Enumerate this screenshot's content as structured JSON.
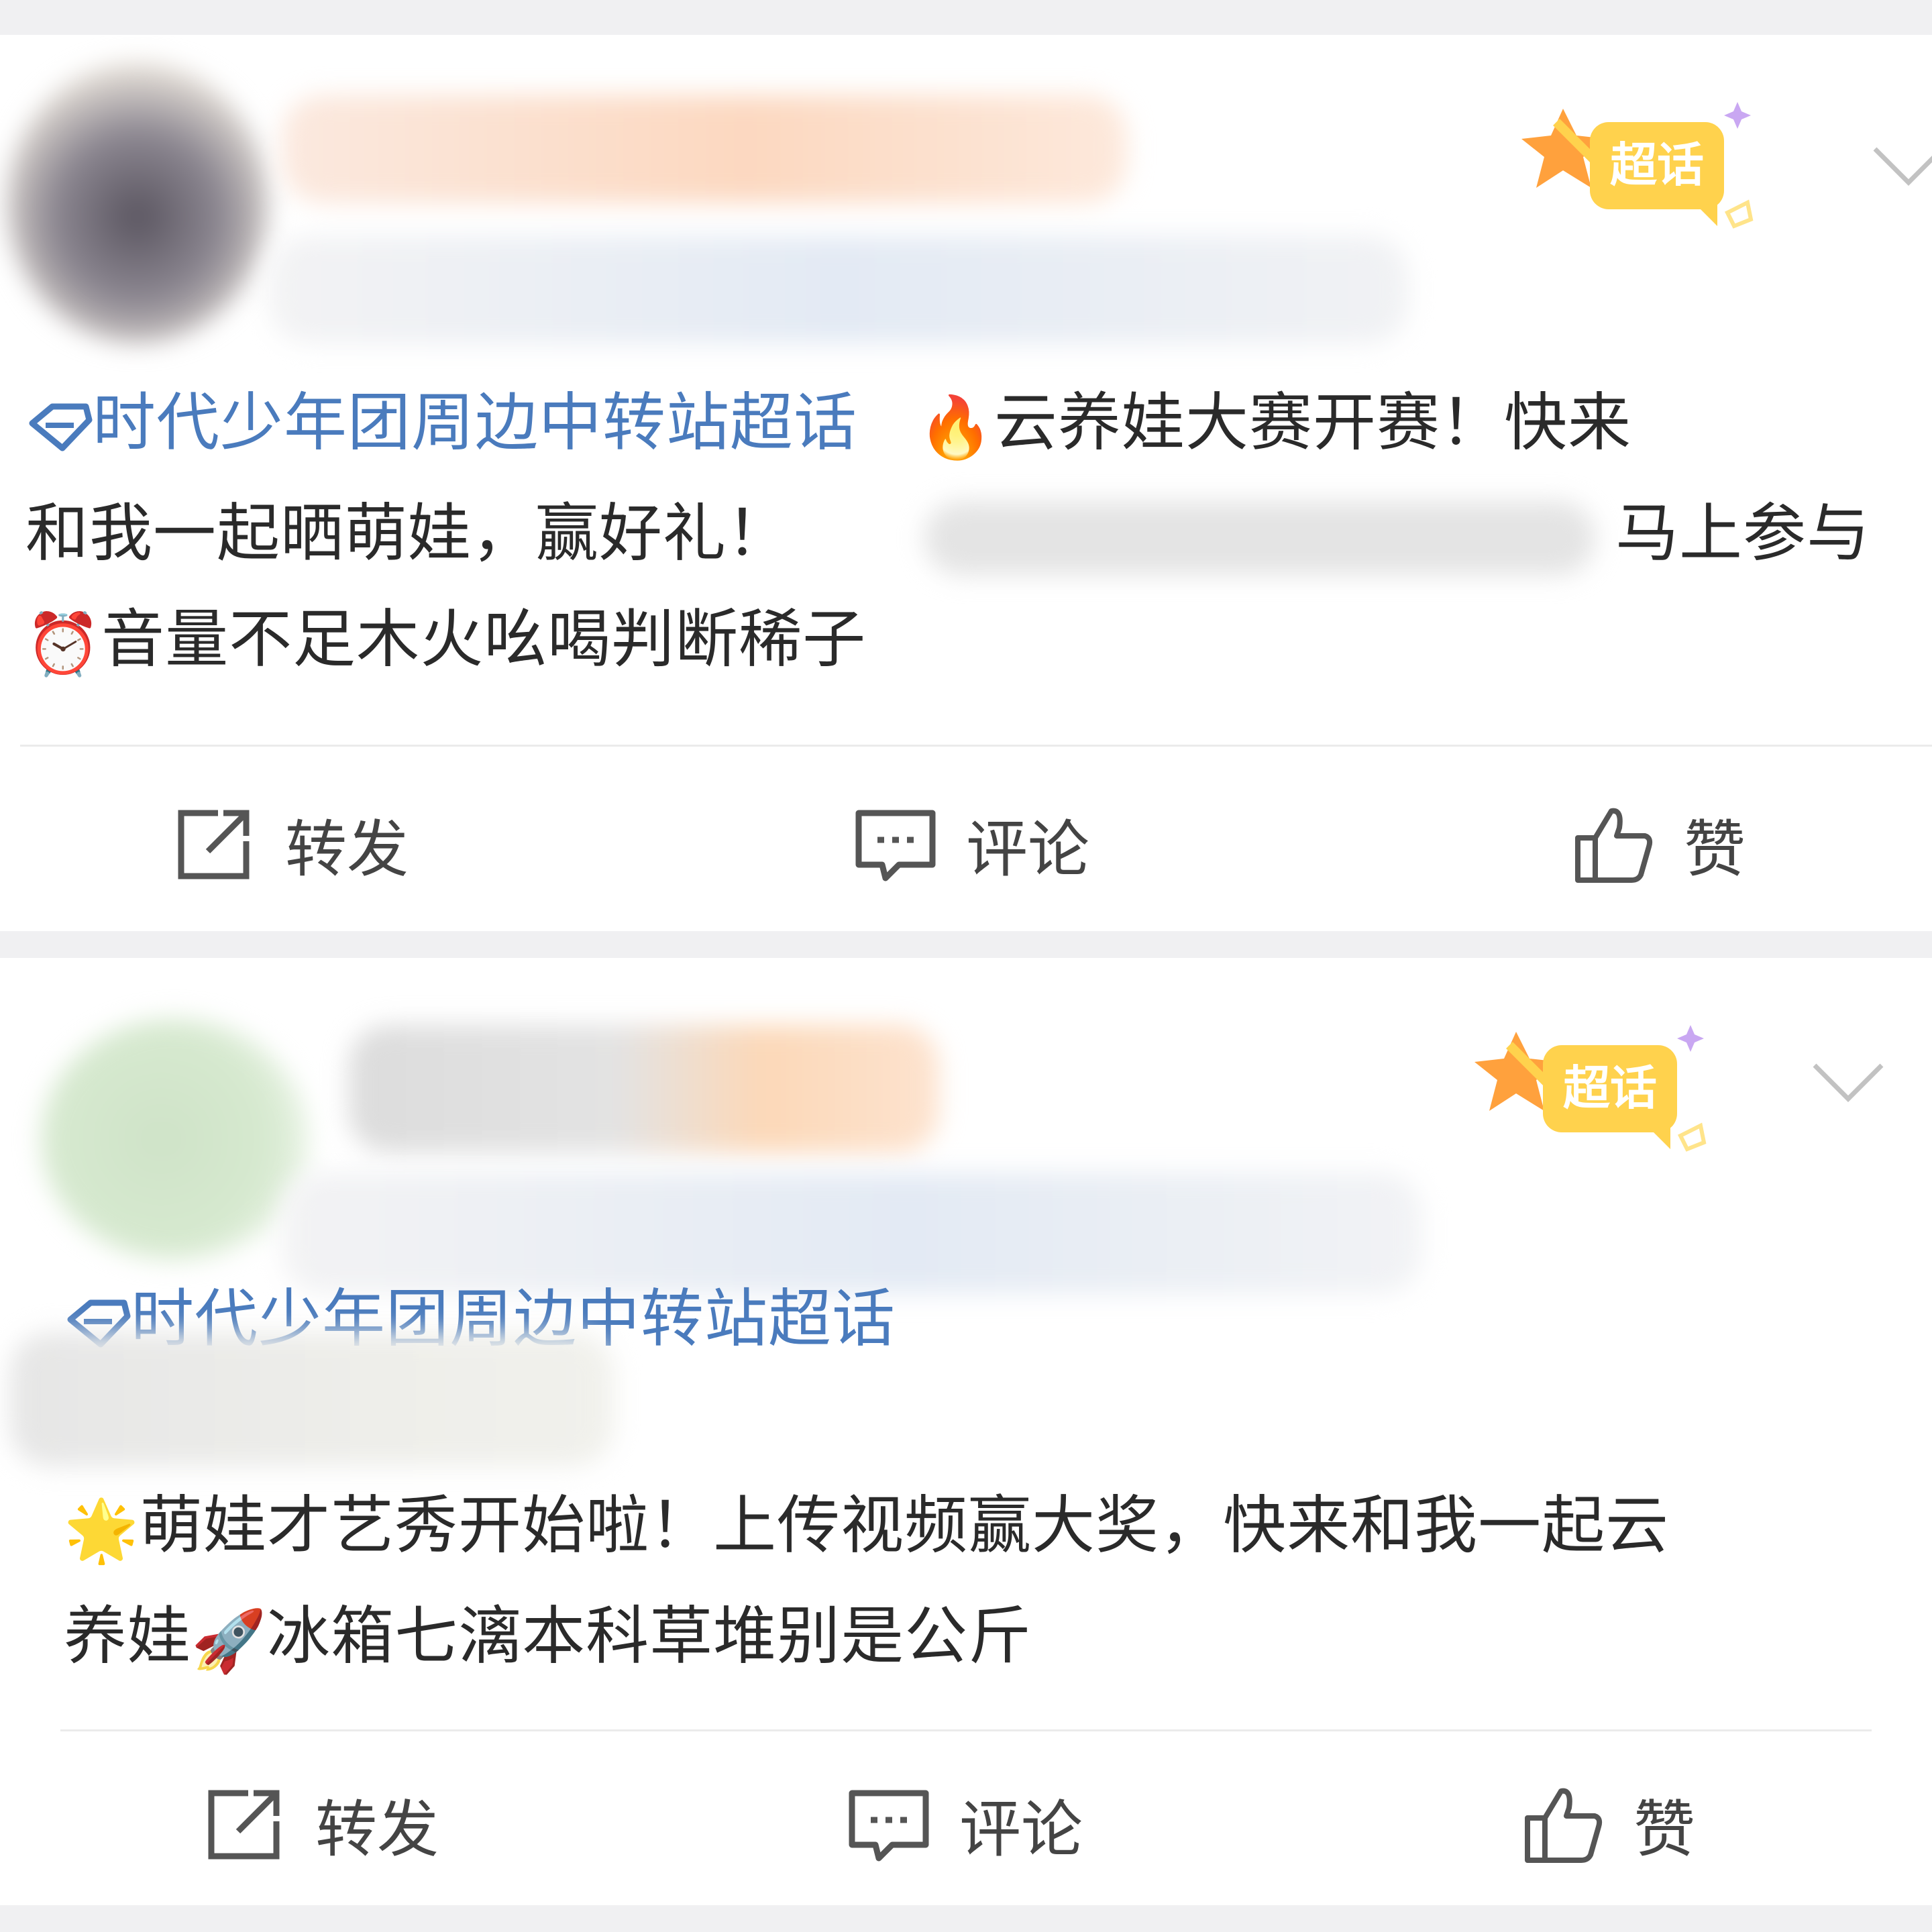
{
  "posts": [
    {
      "badge_label": "超话",
      "topic": "时代少年团周边中转站超话",
      "line1_emoji": "🔥",
      "line1_text": "云养娃大赛开赛！快来",
      "line2_text": "和我一起晒萌娃，赢好礼！",
      "line2_tail": "马上参与",
      "line3_emoji": "⏰",
      "line3_text": "音量不足木火吆喝判断稀子",
      "actions": {
        "repost": "转发",
        "comment": "评论",
        "like": "赞"
      }
    },
    {
      "badge_label": "超话",
      "topic": "时代少年团周边中转站超话",
      "line1_emoji": "🌟",
      "line1_text": "萌娃才艺秀开始啦！上传视频赢大奖，快来和我一起云",
      "line2_text": "养娃",
      "line2_emoji": "🚀",
      "line2_tail": "冰箱七漓本科草堆别是公斤",
      "actions": {
        "repost": "转发",
        "comment": "评论",
        "like": "赞"
      }
    }
  ],
  "colors": {
    "topic": "#4a7bbd",
    "badge": "#ffd24d",
    "text": "#2a2a2a",
    "background": "#f0f0f2"
  }
}
